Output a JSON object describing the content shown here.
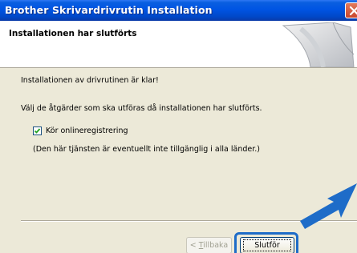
{
  "window": {
    "title": "Brother Skrivardrivrutin Installation"
  },
  "header": {
    "title": "Installationen har slutförts"
  },
  "body": {
    "line1": "Installationen av drivrutinen är klar!",
    "line2": "Välj de åtgärder som ska utföras då installationen har slutförts.",
    "checkbox_label": "Kör onlineregistrering",
    "checkbox_checked": true,
    "note": "(Den här tjänsten är eventuellt inte tillgänglig i alla länder.)"
  },
  "buttons": {
    "back_prefix": "< ",
    "back_accel": "T",
    "back_rest": "illbaka",
    "finish_label": "Slutför"
  },
  "colors": {
    "highlight": "#1e6cc8",
    "arrow": "#1e6cc8"
  }
}
